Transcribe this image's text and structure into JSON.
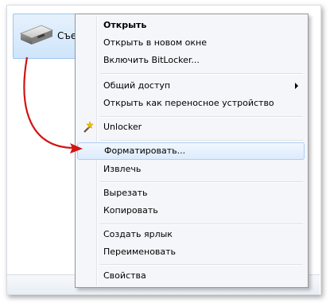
{
  "drive": {
    "label": "Съе",
    "icon": "usb-drive-icon"
  },
  "menu": {
    "items": [
      {
        "label": "Открыть",
        "bold": true
      },
      {
        "label": "Открыть в новом окне"
      },
      {
        "label": "Включить BitLocker..."
      },
      {
        "label": "Общий доступ",
        "submenu": true
      },
      {
        "label": "Открыть как переносное устройство"
      },
      {
        "label": "Unlocker",
        "icon": "magic-wand-icon"
      },
      {
        "label": "Форматировать...",
        "highlighted": true
      },
      {
        "label": "Извлечь"
      },
      {
        "label": "Вырезать"
      },
      {
        "label": "Копировать"
      },
      {
        "label": "Создать ярлык"
      },
      {
        "label": "Переименовать"
      },
      {
        "label": "Свойства"
      }
    ]
  },
  "colors": {
    "annotation_arrow": "#d21414",
    "highlight": "#dcebfc"
  }
}
